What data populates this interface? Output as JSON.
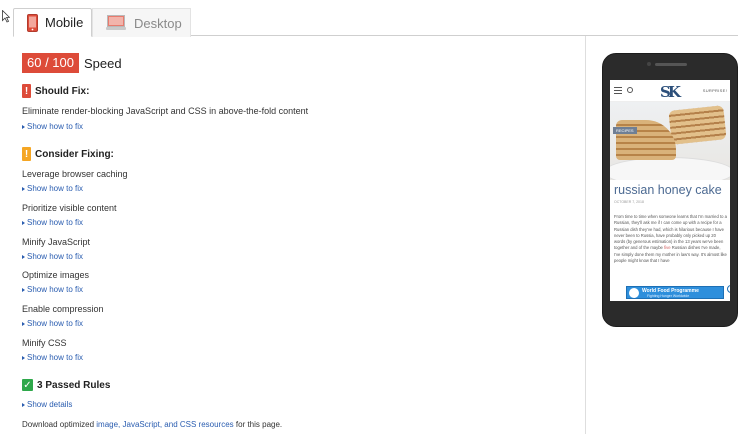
{
  "tabs": [
    {
      "label": "Mobile",
      "active": true,
      "icon": "mobile-phone-icon"
    },
    {
      "label": "Desktop",
      "active": false,
      "icon": "desktop-monitor-icon"
    }
  ],
  "score": {
    "value": "60 / 100",
    "label": "Speed",
    "color": "#dd4b39"
  },
  "should_fix": {
    "heading": "Should Fix:",
    "rules": [
      {
        "title": "Eliminate render-blocking JavaScript and CSS in above-the-fold content",
        "link": "Show how to fix"
      }
    ]
  },
  "consider_fixing": {
    "heading": "Consider Fixing:",
    "rules": [
      {
        "title": "Leverage browser caching",
        "link": "Show how to fix"
      },
      {
        "title": "Prioritize visible content",
        "link": "Show how to fix"
      },
      {
        "title": "Minify JavaScript",
        "link": "Show how to fix"
      },
      {
        "title": "Optimize images",
        "link": "Show how to fix"
      },
      {
        "title": "Enable compression",
        "link": "Show how to fix"
      },
      {
        "title": "Minify CSS",
        "link": "Show how to fix"
      }
    ]
  },
  "passed": {
    "heading": "3 Passed Rules",
    "link": "Show details"
  },
  "footer": {
    "prefix": "Download optimized ",
    "link": "image, JavaScript, and CSS resources",
    "suffix": " for this page."
  },
  "preview": {
    "logo": "SK",
    "surprise": "SURPRISE!",
    "tag": "RECIPES",
    "title": "russian honey cake",
    "date": "OCTOBER 7, 2018",
    "body_before": "From time to time when someone learns that I'm married to a Russian, they'll ask me if I can come up with a recipe for a Russian dish they've had, which is hilarious because I have never been to Russia, have probably only picked up 20 words (by generous estimation) in the 13 years we've been together and of the maybe ",
    "body_highlight": "five",
    "body_after": " Russian dishes I've made, I've simply done them my mother in law's way. It's almost like people might know that I have",
    "ad_title": "World Food Programme",
    "ad_sub": "Fighting Hunger Worldwide",
    "ad_close": "×"
  },
  "colors": {
    "red": "#dd4b39",
    "orange": "#f5a623",
    "green": "#2ea84a",
    "link": "#2a5db0"
  }
}
